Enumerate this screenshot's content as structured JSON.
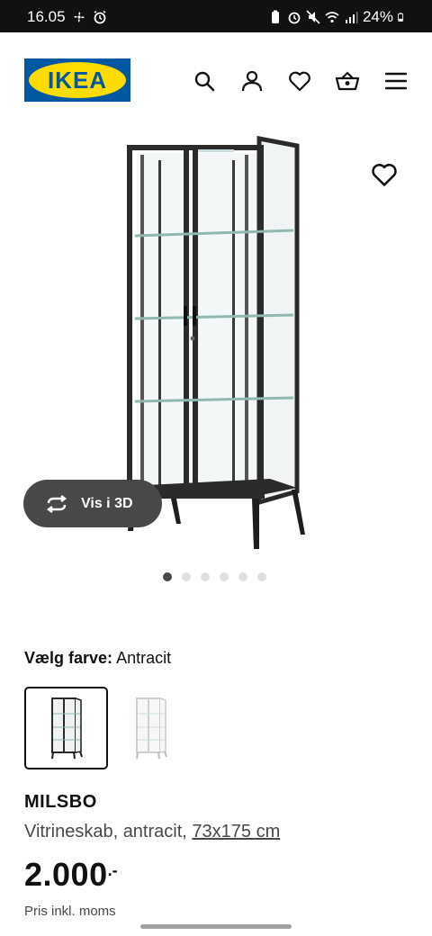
{
  "status_bar": {
    "time": "16.05",
    "battery": "24%"
  },
  "header": {
    "logo_text": "IKEA",
    "brand_colors": {
      "blue": "#0058a3",
      "yellow": "#ffdb00"
    },
    "icons": [
      "search-icon",
      "user-icon",
      "heart-icon",
      "basket-icon",
      "menu-icon"
    ]
  },
  "gallery": {
    "view_3d_label": "Vis i 3D",
    "dots_total": 6,
    "active_dot": 1
  },
  "color_selector": {
    "label": "Vælg farve:",
    "selected_value": "Antracit",
    "options": [
      "antracit",
      "hvid"
    ]
  },
  "product": {
    "name": "MILSBO",
    "description": "Vitrineskab, antracit, ",
    "dimensions": "73x175 cm",
    "price": "2.000",
    "price_suffix": ".-",
    "price_note": "Pris inkl. moms"
  }
}
